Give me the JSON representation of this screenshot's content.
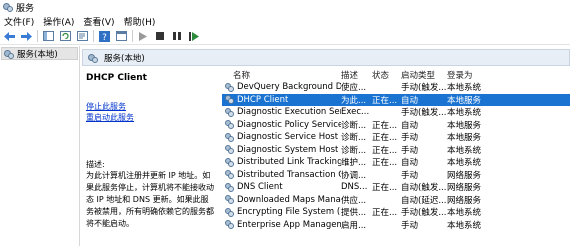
{
  "window": {
    "title": "服务"
  },
  "menu": [
    "文件(F)",
    "操作(A)",
    "查看(V)",
    "帮助(H)"
  ],
  "toolbar": {
    "icons": [
      "back-icon",
      "forward-icon",
      "console-tree-icon",
      "refresh-icon",
      "export-icon",
      "help-icon",
      "properties-icon",
      "play-icon",
      "stop-icon",
      "pause-icon",
      "restart-icon"
    ]
  },
  "tree": {
    "root_label": "服务(本地)"
  },
  "pane": {
    "header_label": "服务(本地)"
  },
  "description_panel": {
    "service_name": "DHCP Client",
    "stop_link": "停止此服务",
    "restart_link": "重启动此服务",
    "desc_label": "描述:",
    "desc_text": "为此计算机注册并更新 IP 地址。如果此服务停止，计算机将不能接收动态 IP 地址和 DNS 更新。如果此服务被禁用，所有明确依赖它的服务都将不能启动。"
  },
  "table": {
    "columns": [
      "名称",
      "描述",
      "状态",
      "启动类型",
      "登录为"
    ],
    "rows": [
      {
        "name": "DevQuery Background Dis...",
        "desc": "使应...",
        "status": "",
        "startup": "手动(触发...",
        "logon": "本地系统"
      },
      {
        "name": "DHCP Client",
        "desc": "为此...",
        "status": "正在...",
        "startup": "自动",
        "logon": "本地服务"
      },
      {
        "name": "Diagnostic Execution Service",
        "desc": "Exec...",
        "status": "",
        "startup": "手动(触发...",
        "logon": "本地系统"
      },
      {
        "name": "Diagnostic Policy Service",
        "desc": "诊断...",
        "status": "正在...",
        "startup": "自动",
        "logon": "本地服务"
      },
      {
        "name": "Diagnostic Service Host",
        "desc": "诊断...",
        "status": "正在...",
        "startup": "手动",
        "logon": "本地服务"
      },
      {
        "name": "Diagnostic System Host",
        "desc": "诊断...",
        "status": "正在...",
        "startup": "手动",
        "logon": "本地系统"
      },
      {
        "name": "Distributed Link Tracking C...",
        "desc": "维护...",
        "status": "正在...",
        "startup": "自动",
        "logon": "本地系统"
      },
      {
        "name": "Distributed Transaction Co...",
        "desc": "协调...",
        "status": "",
        "startup": "手动",
        "logon": "网络服务"
      },
      {
        "name": "DNS Client",
        "desc": "DNS...",
        "status": "正在...",
        "startup": "自动(触发...",
        "logon": "网络服务"
      },
      {
        "name": "Downloaded Maps Manager",
        "desc": "供应...",
        "status": "",
        "startup": "自动(延迟...",
        "logon": "网络服务"
      },
      {
        "name": "Encrypting File System (EFS)",
        "desc": "提供...",
        "status": "正在...",
        "startup": "手动(触发...",
        "logon": "本地系统"
      },
      {
        "name": "Enterprise App Manageme...",
        "desc": "启用...",
        "status": "",
        "startup": "手动",
        "logon": "本地系统"
      }
    ],
    "selected_index": 1
  },
  "colors": {
    "selection": "#1a73d1",
    "link": "#0033cc",
    "pane_header": "#e8eef5"
  }
}
